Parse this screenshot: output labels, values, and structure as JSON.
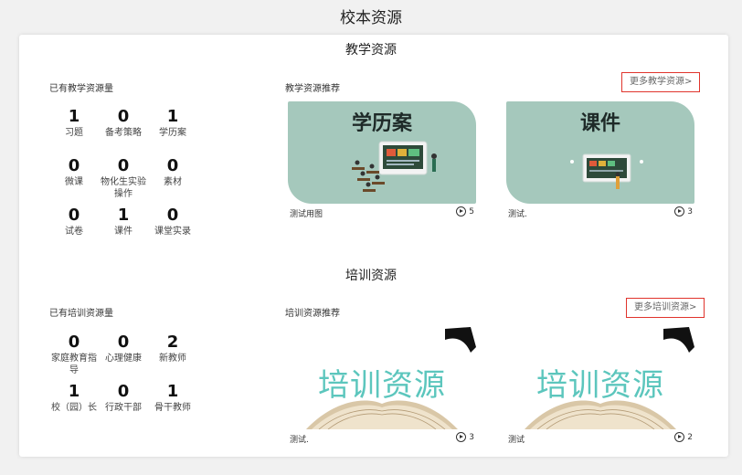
{
  "page": {
    "title": "校本资源"
  },
  "teaching": {
    "section_title": "教学资源",
    "stats_label": "已有教学资源量",
    "stats": [
      {
        "value": "1",
        "label": "习题"
      },
      {
        "value": "0",
        "label": "备考策略"
      },
      {
        "value": "1",
        "label": "学历案"
      },
      {
        "value": "0",
        "label": "微课"
      },
      {
        "value": "0",
        "label": "物化生实验操作"
      },
      {
        "value": "0",
        "label": "素材"
      },
      {
        "value": "0",
        "label": "试卷"
      },
      {
        "value": "1",
        "label": "课件"
      },
      {
        "value": "0",
        "label": "课堂实录"
      }
    ],
    "recommend_label": "教学资源推荐",
    "more_label": "更多教学资源>",
    "cards": [
      {
        "thumb_title": "学历案",
        "name": "测试用图",
        "views": "5",
        "icon": "classroom-illustration"
      },
      {
        "thumb_title": "课件",
        "name": "测试.",
        "views": "3",
        "icon": "blackboard-illustration"
      }
    ]
  },
  "training": {
    "section_title": "培训资源",
    "stats_label": "已有培训资源量",
    "stats": [
      {
        "value": "0",
        "label": "家庭教育指导"
      },
      {
        "value": "0",
        "label": "心理健康"
      },
      {
        "value": "2",
        "label": "新教师"
      },
      {
        "value": "1",
        "label": "校（园）长"
      },
      {
        "value": "0",
        "label": "行政干部"
      },
      {
        "value": "1",
        "label": "骨干教师"
      }
    ],
    "recommend_label": "培训资源推荐",
    "more_label": "更多培训资源>",
    "cards": [
      {
        "thumb_title": "培训资源",
        "name": "测试.",
        "views": "3",
        "icon": "open-book-illustration"
      },
      {
        "thumb_title": "培训资源",
        "name": "测试",
        "views": "2",
        "icon": "open-book-illustration"
      }
    ]
  },
  "colors": {
    "accent_border": "#e0342c",
    "thumb_green": "#a5c8bc",
    "training_text": "#5cc6bd"
  }
}
